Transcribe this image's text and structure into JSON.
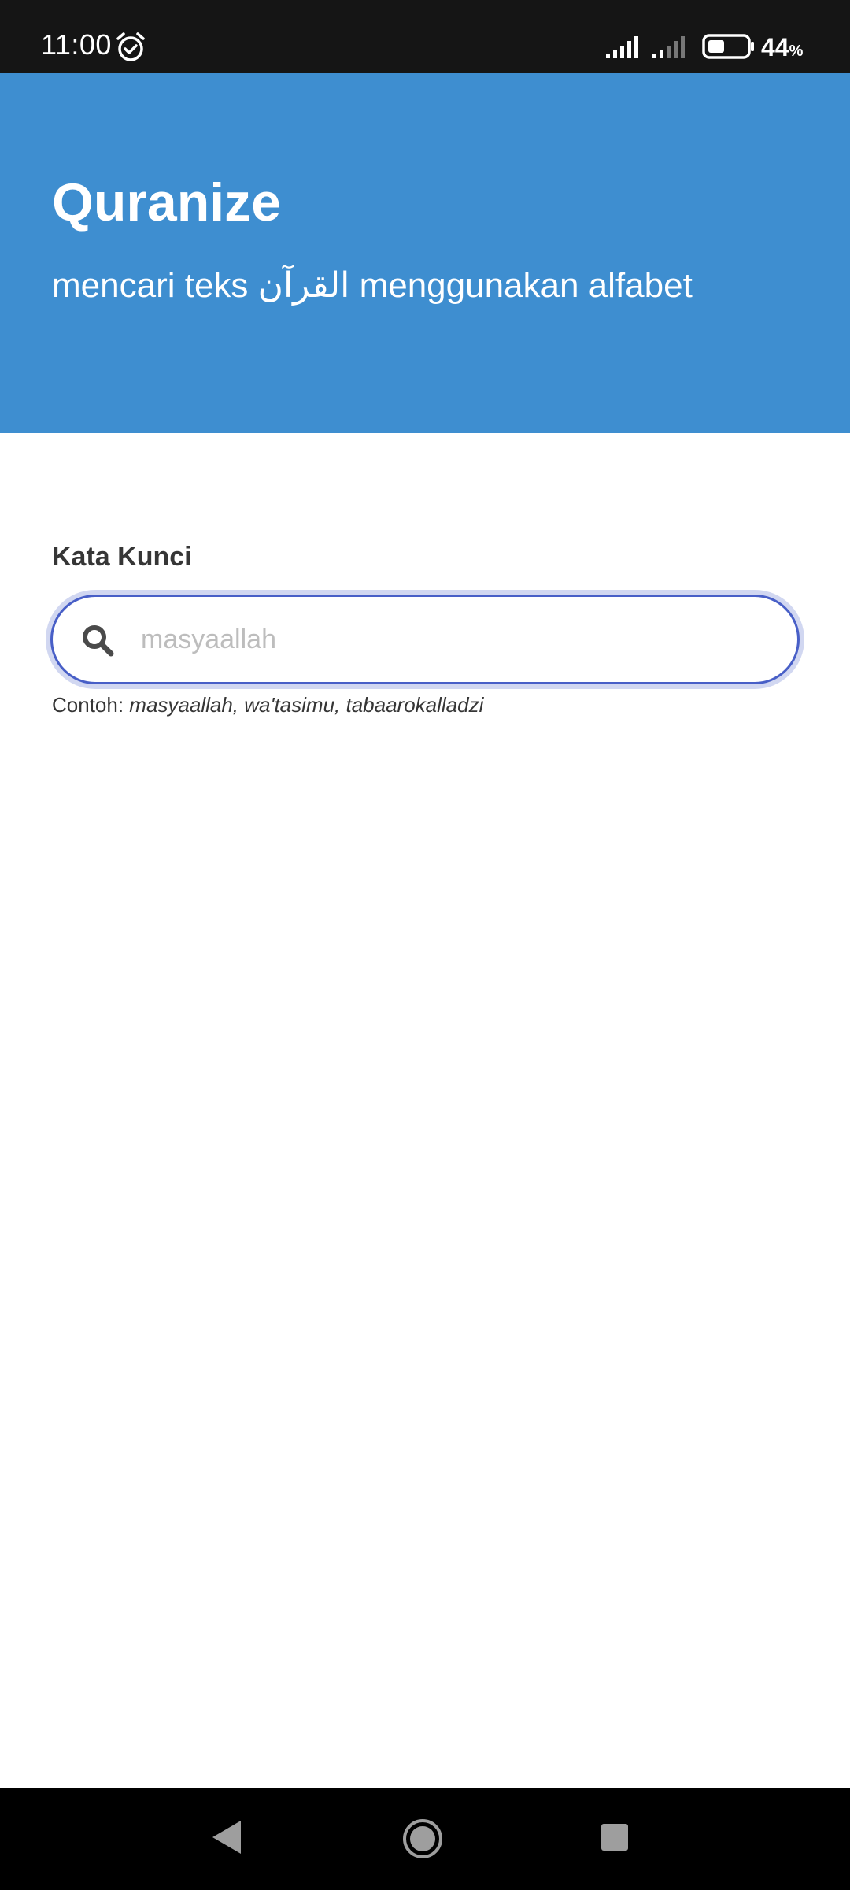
{
  "status_bar": {
    "time": "11:00",
    "battery_percent": "44",
    "battery_unit": "%",
    "battery_level": 0.44,
    "icons": [
      "alarm-icon",
      "signal-icon",
      "signal-icon",
      "battery-icon"
    ]
  },
  "header": {
    "title": "Quranize",
    "subtitle": "mencari teks القرآن menggunakan alfabet",
    "background_color": "#3e8ed0"
  },
  "search": {
    "label": "Kata Kunci",
    "value": "",
    "placeholder": "masyaallah",
    "icon": "search-icon",
    "focus_color": "#485fc7"
  },
  "help": {
    "prefix": "Contoh: ",
    "examples": "masyaallah, wa'tasimu, tabaarokalladzi"
  },
  "nav_bar": {
    "icons": [
      "back-icon",
      "home-icon",
      "recents-icon"
    ]
  }
}
